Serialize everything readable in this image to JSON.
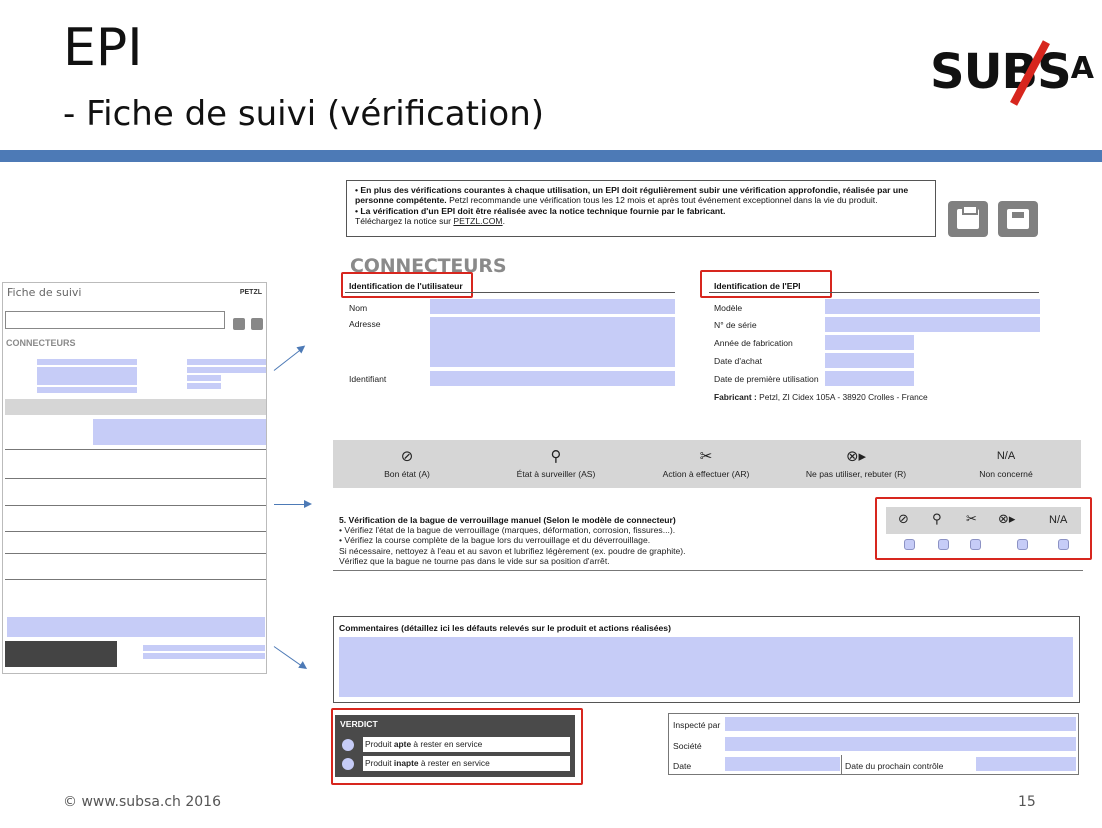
{
  "header": {
    "title": "EPI",
    "subtitle": "- Fiche de suivi (vérification)",
    "logo": "SUBS",
    "logo_suffix": "A"
  },
  "thumbnail": {
    "heading": "Fiche de suivi",
    "brand": "PETZL",
    "section": "CONNECTEURS"
  },
  "notice": {
    "line1_bold": "• En plus des vérifications courantes à chaque utilisation, un EPI doit régulièrement subir une vérification approfondie, réalisée par une personne compétente.",
    "line1_rest": " Petzl recommande une vérification tous les 12 mois et après tout événement exceptionnel dans la vie du produit.",
    "line2_bold": "• La vérification d'un EPI doit être réalisée avec la notice technique fournie par le fabricant.",
    "line3_text": "Téléchargez la notice sur ",
    "line3_link": "PETZL.COM",
    "line3_end": "."
  },
  "toolbar": {
    "print_icon": "printer-icon",
    "save_icon": "floppy-disk-icon"
  },
  "connecteurs": {
    "title": "CONNECTEURS",
    "user_section": "Identification de l'utilisateur",
    "epi_section": "Identification de l'EPI",
    "user_fields": {
      "name": "Nom",
      "address": "Adresse",
      "id": "Identifiant"
    },
    "epi_fields": {
      "model": "Modèle",
      "serial": "N° de série",
      "year": "Année de fabrication",
      "purchase": "Date d'achat",
      "first_use": "Date de première utilisation"
    },
    "manufacturer_label": "Fabricant :",
    "manufacturer_value": " Petzl, ZI Cidex 105A - 38920 Crolles - France"
  },
  "legend": [
    {
      "icon": "check-circle-icon",
      "glyph": "⊘",
      "label": "Bon état (A)"
    },
    {
      "icon": "magnifier-icon",
      "glyph": "⚲",
      "label": "État à surveiller (AS)"
    },
    {
      "icon": "tools-icon",
      "glyph": "✂",
      "label": "Action à effectuer (AR)"
    },
    {
      "icon": "reject-bin-icon",
      "glyph": "⊗▸",
      "label": "Ne pas utiliser, rebuter (R)"
    },
    {
      "icon": "na-icon",
      "glyph": "N/A",
      "label": "Non concerné"
    }
  ],
  "check5": {
    "title": "5. Vérification de la bague de verrouillage manuel (Selon le modèle de connecteur)",
    "l1": "• Vérifiez l'état de la bague de verrouillage (marques, déformation, corrosion, fissures...).",
    "l2": "• Vérifiez la course complète de la bague lors du verrouillage et du déverrouillage.",
    "l3": "Si nécessaire, nettoyez à l'eau et au savon et lubrifiez légèrement (ex. poudre de graphite).",
    "l4": "Vérifiez que la bague ne tourne pas dans le vide sur sa position d'arrêt.",
    "na": "N/A"
  },
  "comments": {
    "title": "Commentaires (détaillez ici les défauts relevés sur le produit et actions réalisées)"
  },
  "verdict": {
    "title": "VERDICT",
    "opt1_pre": "Produit ",
    "opt1_bold": "apte",
    "opt1_post": " à rester en service",
    "opt2_pre": "Produit ",
    "opt2_bold": "inapte",
    "opt2_post": " à rester en service"
  },
  "inspection": {
    "inspected_by": "Inspecté par",
    "company": "Société",
    "date": "Date",
    "next_control": "Date du prochain contrôle"
  },
  "footer": {
    "copyright": "© www.subsa.ch 2016",
    "page": "15"
  },
  "colors": {
    "band_blue": "#4d7ab6",
    "highlight_red": "#d7261e",
    "field_fill": "#c6ccf7",
    "legend_grey": "#d6d6d6"
  }
}
